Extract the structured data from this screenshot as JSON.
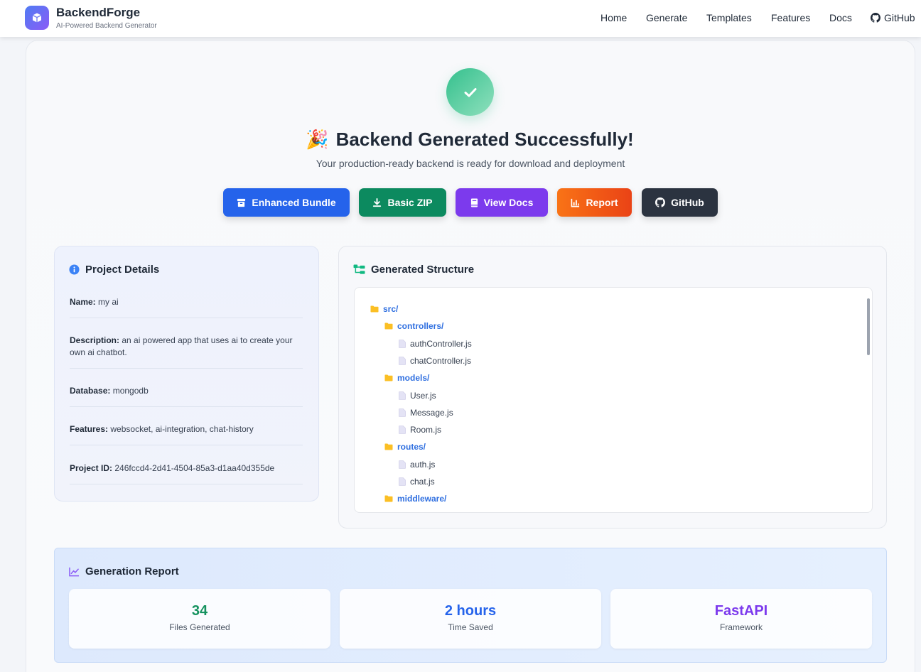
{
  "header": {
    "brand_name": "BackendForge",
    "brand_sub": "AI-Powered Backend Generator",
    "nav": [
      "Home",
      "Generate",
      "Templates",
      "Features",
      "Docs",
      "GitHub"
    ]
  },
  "hero": {
    "emoji": "🎉",
    "title": "Backend Generated Successfully!",
    "subtitle": "Your production-ready backend is ready for download and deployment"
  },
  "actions": {
    "bundle": "Enhanced Bundle",
    "zip": "Basic ZIP",
    "docs": "View Docs",
    "report": "Report",
    "github": "GitHub"
  },
  "details": {
    "title": "Project Details",
    "name_label": "Name:",
    "name": "my ai",
    "description_label": "Description:",
    "description": "an ai powered app that uses ai to create your own ai chatbot.",
    "database_label": "Database:",
    "database": "mongodb",
    "features_label": "Features:",
    "features": "websocket, ai-integration, chat-history",
    "project_id_label": "Project ID:",
    "project_id": "246fccd4-2d41-4504-85a3-d1aa40d355de"
  },
  "structure": {
    "title": "Generated Structure",
    "tree": [
      {
        "name": "src/",
        "type": "folder",
        "depth": 0
      },
      {
        "name": "controllers/",
        "type": "folder",
        "depth": 1
      },
      {
        "name": "authController.js",
        "type": "file",
        "depth": 2
      },
      {
        "name": "chatController.js",
        "type": "file",
        "depth": 2
      },
      {
        "name": "models/",
        "type": "folder",
        "depth": 1
      },
      {
        "name": "User.js",
        "type": "file",
        "depth": 2
      },
      {
        "name": "Message.js",
        "type": "file",
        "depth": 2
      },
      {
        "name": "Room.js",
        "type": "file",
        "depth": 2
      },
      {
        "name": "routes/",
        "type": "folder",
        "depth": 1
      },
      {
        "name": "auth.js",
        "type": "file",
        "depth": 2
      },
      {
        "name": "chat.js",
        "type": "file",
        "depth": 2
      },
      {
        "name": "middleware/",
        "type": "folder",
        "depth": 1
      }
    ]
  },
  "report": {
    "title": "Generation Report",
    "stats": [
      {
        "value": "34",
        "label": "Files Generated",
        "color": "#15925f"
      },
      {
        "value": "2 hours",
        "label": "Time Saved",
        "color": "#2563eb"
      },
      {
        "value": "FastAPI",
        "label": "Framework",
        "color": "#7c3aed"
      }
    ]
  },
  "colors": {
    "primary": "#2563eb",
    "success": "#0c8a5f",
    "purple": "#7c3aed",
    "orange": "#f97316",
    "dark": "#2b3340",
    "folder": "#fbbf24"
  }
}
